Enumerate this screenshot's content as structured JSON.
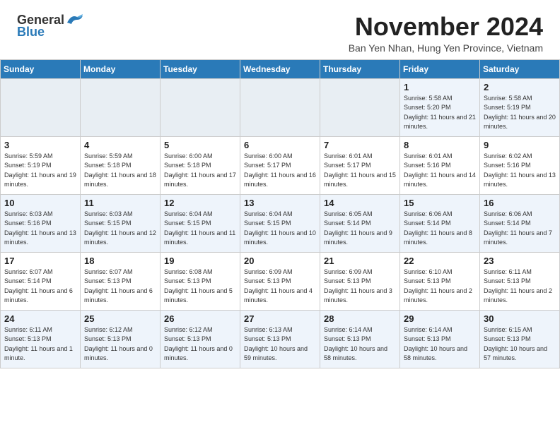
{
  "header": {
    "logo_general": "General",
    "logo_blue": "Blue",
    "month_title": "November 2024",
    "location": "Ban Yen Nhan, Hung Yen Province, Vietnam"
  },
  "weekdays": [
    "Sunday",
    "Monday",
    "Tuesday",
    "Wednesday",
    "Thursday",
    "Friday",
    "Saturday"
  ],
  "weeks": [
    [
      {
        "day": "",
        "empty": true
      },
      {
        "day": "",
        "empty": true
      },
      {
        "day": "",
        "empty": true
      },
      {
        "day": "",
        "empty": true
      },
      {
        "day": "",
        "empty": true
      },
      {
        "day": "1",
        "sunrise": "5:58 AM",
        "sunset": "5:20 PM",
        "daylight": "11 hours and 21 minutes."
      },
      {
        "day": "2",
        "sunrise": "5:58 AM",
        "sunset": "5:19 PM",
        "daylight": "11 hours and 20 minutes."
      }
    ],
    [
      {
        "day": "3",
        "sunrise": "5:59 AM",
        "sunset": "5:19 PM",
        "daylight": "11 hours and 19 minutes."
      },
      {
        "day": "4",
        "sunrise": "5:59 AM",
        "sunset": "5:18 PM",
        "daylight": "11 hours and 18 minutes."
      },
      {
        "day": "5",
        "sunrise": "6:00 AM",
        "sunset": "5:18 PM",
        "daylight": "11 hours and 17 minutes."
      },
      {
        "day": "6",
        "sunrise": "6:00 AM",
        "sunset": "5:17 PM",
        "daylight": "11 hours and 16 minutes."
      },
      {
        "day": "7",
        "sunrise": "6:01 AM",
        "sunset": "5:17 PM",
        "daylight": "11 hours and 15 minutes."
      },
      {
        "day": "8",
        "sunrise": "6:01 AM",
        "sunset": "5:16 PM",
        "daylight": "11 hours and 14 minutes."
      },
      {
        "day": "9",
        "sunrise": "6:02 AM",
        "sunset": "5:16 PM",
        "daylight": "11 hours and 13 minutes."
      }
    ],
    [
      {
        "day": "10",
        "sunrise": "6:03 AM",
        "sunset": "5:16 PM",
        "daylight": "11 hours and 13 minutes."
      },
      {
        "day": "11",
        "sunrise": "6:03 AM",
        "sunset": "5:15 PM",
        "daylight": "11 hours and 12 minutes."
      },
      {
        "day": "12",
        "sunrise": "6:04 AM",
        "sunset": "5:15 PM",
        "daylight": "11 hours and 11 minutes."
      },
      {
        "day": "13",
        "sunrise": "6:04 AM",
        "sunset": "5:15 PM",
        "daylight": "11 hours and 10 minutes."
      },
      {
        "day": "14",
        "sunrise": "6:05 AM",
        "sunset": "5:14 PM",
        "daylight": "11 hours and 9 minutes."
      },
      {
        "day": "15",
        "sunrise": "6:06 AM",
        "sunset": "5:14 PM",
        "daylight": "11 hours and 8 minutes."
      },
      {
        "day": "16",
        "sunrise": "6:06 AM",
        "sunset": "5:14 PM",
        "daylight": "11 hours and 7 minutes."
      }
    ],
    [
      {
        "day": "17",
        "sunrise": "6:07 AM",
        "sunset": "5:14 PM",
        "daylight": "11 hours and 6 minutes."
      },
      {
        "day": "18",
        "sunrise": "6:07 AM",
        "sunset": "5:13 PM",
        "daylight": "11 hours and 6 minutes."
      },
      {
        "day": "19",
        "sunrise": "6:08 AM",
        "sunset": "5:13 PM",
        "daylight": "11 hours and 5 minutes."
      },
      {
        "day": "20",
        "sunrise": "6:09 AM",
        "sunset": "5:13 PM",
        "daylight": "11 hours and 4 minutes."
      },
      {
        "day": "21",
        "sunrise": "6:09 AM",
        "sunset": "5:13 PM",
        "daylight": "11 hours and 3 minutes."
      },
      {
        "day": "22",
        "sunrise": "6:10 AM",
        "sunset": "5:13 PM",
        "daylight": "11 hours and 2 minutes."
      },
      {
        "day": "23",
        "sunrise": "6:11 AM",
        "sunset": "5:13 PM",
        "daylight": "11 hours and 2 minutes."
      }
    ],
    [
      {
        "day": "24",
        "sunrise": "6:11 AM",
        "sunset": "5:13 PM",
        "daylight": "11 hours and 1 minute."
      },
      {
        "day": "25",
        "sunrise": "6:12 AM",
        "sunset": "5:13 PM",
        "daylight": "11 hours and 0 minutes."
      },
      {
        "day": "26",
        "sunrise": "6:12 AM",
        "sunset": "5:13 PM",
        "daylight": "11 hours and 0 minutes."
      },
      {
        "day": "27",
        "sunrise": "6:13 AM",
        "sunset": "5:13 PM",
        "daylight": "10 hours and 59 minutes."
      },
      {
        "day": "28",
        "sunrise": "6:14 AM",
        "sunset": "5:13 PM",
        "daylight": "10 hours and 58 minutes."
      },
      {
        "day": "29",
        "sunrise": "6:14 AM",
        "sunset": "5:13 PM",
        "daylight": "10 hours and 58 minutes."
      },
      {
        "day": "30",
        "sunrise": "6:15 AM",
        "sunset": "5:13 PM",
        "daylight": "10 hours and 57 minutes."
      }
    ]
  ],
  "labels": {
    "sunrise": "Sunrise:",
    "sunset": "Sunset:",
    "daylight": "Daylight:"
  }
}
